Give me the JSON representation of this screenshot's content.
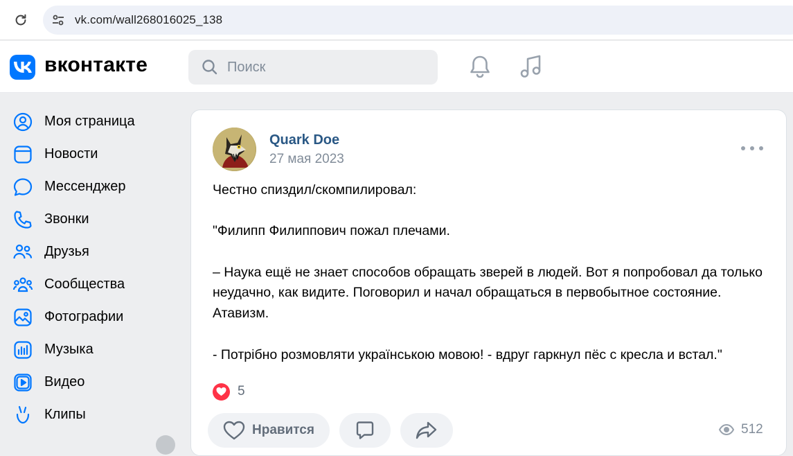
{
  "browser": {
    "url": "vk.com/wall268016025_138"
  },
  "header": {
    "brand": "вконтакте",
    "search_placeholder": "Поиск"
  },
  "sidebar": {
    "items": [
      {
        "label": "Моя страница",
        "icon": "user-circle-icon"
      },
      {
        "label": "Новости",
        "icon": "news-icon"
      },
      {
        "label": "Мессенджер",
        "icon": "message-bubble-icon"
      },
      {
        "label": "Звонки",
        "icon": "phone-icon"
      },
      {
        "label": "Друзья",
        "icon": "friends-icon"
      },
      {
        "label": "Сообщества",
        "icon": "communities-icon"
      },
      {
        "label": "Фотографии",
        "icon": "photo-icon"
      },
      {
        "label": "Музыка",
        "icon": "music-icon"
      },
      {
        "label": "Видео",
        "icon": "video-icon"
      },
      {
        "label": "Клипы",
        "icon": "clips-icon"
      }
    ]
  },
  "post": {
    "author": "Quark Doe",
    "date": "27 мая 2023",
    "text": {
      "line1": "Честно спиздил/скомпилировал:",
      "line2": "\"Филипп Филиппович пожал плечами.",
      "line3": "– Наука ещё не знает способов обращать зверей в людей. Вот я попробовал да только неудачно, как видите. Поговорил и начал обращаться в первобытное состояние. Атавизм.",
      "line4": "- Потрібно розмовляти українською мовою! - вдруг гаркнул пёс с кресла и встал.\""
    },
    "likes": "5",
    "like_button": "Нравится",
    "views": "512"
  },
  "colors": {
    "accent": "#0077ff",
    "author_link": "#2a5885",
    "like_red": "#ff3347"
  }
}
